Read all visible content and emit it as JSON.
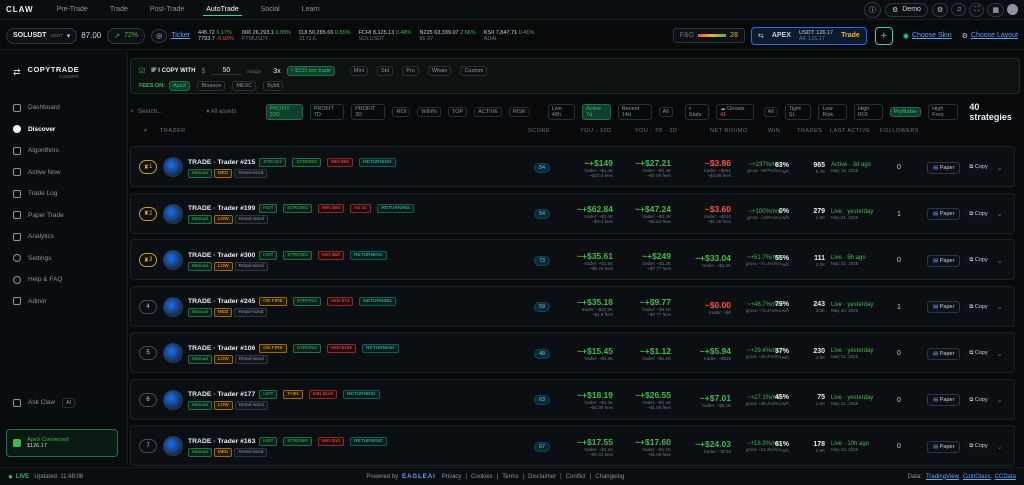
{
  "header": {
    "logo": "CLAW",
    "nav": [
      "Pre-Trade",
      "Trade",
      "Post-Trade",
      "AutoTrade",
      "Social",
      "Learn"
    ],
    "demo": "Demo"
  },
  "ticker": {
    "symbol": "SOLUSDT",
    "tag": "USDT",
    "price": "87.00",
    "change": "72%",
    "ticker_label": "Ticker",
    "quotes": [
      {
        "a": "445.72",
        "b": "0.17%",
        "c": "7793.7",
        "d": "-0.03%"
      },
      {
        "a": "000",
        "b": "26,293.1",
        "c": "0.09%",
        "d": "FTMUSDT"
      },
      {
        "a": "DJI",
        "b": "50,285.66",
        "c": "0.55%",
        "d": "2173.6"
      },
      {
        "a": "FCHI",
        "b": "8,125.13",
        "c": "0.48%",
        "d": "SOLUSDT"
      },
      {
        "a": "N225",
        "b": "63,339.07",
        "c": "2.66%",
        "d": "86.97"
      },
      {
        "a": "KSII",
        "b": "7,847.71",
        "c": "0.41%",
        "d": "ADAI"
      }
    ],
    "fng_label": "F&G",
    "fng_val": "28",
    "apex": "APEX",
    "apex_usdt": "USDT: 126.17",
    "apex_all": "All: 126.17",
    "trade_btn": "Trade",
    "skin": "Choose Skin",
    "layout": "Choose Layout"
  },
  "sidebar": {
    "title": "COPYTRADE",
    "subtitle": "COCKPIT",
    "items": [
      "Dashboard",
      "Discover",
      "Algorithms",
      "Active Now",
      "Trade Log",
      "Paper Trade",
      "Analytics",
      "Settings",
      "Help & FAQ",
      "Admin"
    ],
    "ask": "Ask Claw",
    "ai": "AI",
    "conn": "ApeX Connected",
    "bal": "$126.17"
  },
  "filters": {
    "label": "IF I COPY WITH",
    "amount": "50",
    "margin": "margin",
    "lev": "3x",
    "per": "≈ $150 per trade",
    "risks": [
      "Mini",
      "Std",
      "Pro",
      "Whale",
      "Custom"
    ],
    "fees_label": "FEES ON:",
    "fees": [
      "ApeX",
      "Binance",
      "MEXC",
      "Bybit"
    ]
  },
  "toolbar": {
    "search": "Search...",
    "assets": "All assets",
    "tabs": [
      "PROFIT 30D",
      "PROFIT 7D",
      "PROFIT 3D",
      "ROI",
      "WIN%",
      "TOP",
      "ACTIVE",
      "RISK"
    ],
    "time": [
      "Live 48h",
      "Active 7d",
      "Recent 14d",
      "All"
    ],
    "state": "State",
    "ghosts": "Ghosts",
    "ghost_n": "41",
    "filters2": [
      "All",
      "Tight SL",
      "Low Risk",
      "High ROI",
      "Profitable",
      "High Freq"
    ],
    "count": "40 strategies"
  },
  "columns": [
    "#",
    "TRADER",
    "SCORE",
    "YOU · 30D",
    "YOU · 7D · 3D",
    "NET ROI/MO",
    "WIN",
    "TRADES",
    "LAST ACTIVE",
    "FOLLOWERS"
  ],
  "rows": [
    {
      "rank": "1",
      "name": "TRADE · Trader #215",
      "tags": [
        "STEADY",
        "STRONG",
        "MIN $50",
        "RETURNING"
      ],
      "risk": "MED",
      "score": "54",
      "p30": "~+$149",
      "p30s": "trader: ~$1.4K",
      "p30f": "~$30.6 fees",
      "p7": "~+$27.21",
      "p7s": "trader: ~$1.4K",
      "p7f": "~$7.00 fees",
      "p3": "~$3.86",
      "p3s": "trader: ~$421",
      "p3f": "~$3.86 fees",
      "roi": "~+237%/mo",
      "roi2": "gross ~287%/mo",
      "win": "63%",
      "wins": "w/h",
      "tr": "965",
      "trs": "6.7K",
      "last": "Active · 3d ago",
      "lastd": "May 18, 2025",
      "fol": "0"
    },
    {
      "rank": "2",
      "name": "TRADE · Trader #199",
      "tags": [
        "HOT",
        "STRONG",
        "MIN $50",
        "No SL",
        "RETURNING"
      ],
      "risk": "LOW",
      "score": "54",
      "p30": "~+$62.84",
      "p30s": "trader: ~$2.4K",
      "p30f": "~$3.4 fees",
      "p7": "~+$47.24",
      "p7s": "trader: ~$2.4K",
      "p7f": "~$2.64 fees",
      "p3": "~$3.60",
      "p3s": "trader: ~$140",
      "p3f": "~$1.26 fees",
      "roi": "~+100%/mo",
      "roi2": "gross ~120%/mo",
      "win": "0%",
      "wins": "w/h",
      "tr": "279",
      "trs": "1.6K",
      "last": "Live · yesterday",
      "lastd": "May 21, 2025",
      "fol": "1"
    },
    {
      "rank": "3",
      "name": "TRADE · Trader #300",
      "tags": [
        "HOT",
        "STRONG",
        "MIN $50",
        "RETURNING"
      ],
      "risk": "LOW",
      "score": "73",
      "p30": "~+$35.61",
      "p30s": "trader: ~$1.5K",
      "p30f": "~$6.76 fees",
      "p7": "~+$249",
      "p7s": "trader: ~$2.3K",
      "p7f": "~$7.77 fees",
      "p3": "~+$33.04",
      "p3s": "trader: ~$2.3K",
      "p3f": "",
      "roi": "~+51.7%/mo",
      "roi2": "gross ~71.4%/mo",
      "win": "55%",
      "wins": "w/h",
      "tr": "111",
      "trs": "2.2K",
      "last": "Live · 5h ago",
      "lastd": "May 22, 2025",
      "fol": "0"
    },
    {
      "rank": "4",
      "name": "TRADE · Trader #245",
      "tags": [
        "ON FIRE",
        "STRONG",
        "MIN $74",
        "RETURNING"
      ],
      "risk": "MED",
      "score": "59",
      "p30": "~+$35.18",
      "p30s": "trader: ~$22.9K",
      "p30f": "~$1.8 fees",
      "p7": "~+$9.77",
      "p7s": "trader: ~$8.1K",
      "p7f": "~$7.77 fees",
      "p3": "~$0.00",
      "p3s": "trader: ~$0",
      "p3f": "",
      "roi": "~+46.7%/mo",
      "roi2": "gross ~76.4%/mo",
      "win": "79%",
      "wins": "w/h",
      "tr": "243",
      "trs": "3.6K",
      "last": "Live · yesterday",
      "lastd": "May 20, 2025",
      "fol": "1"
    },
    {
      "rank": "5",
      "name": "TRADE · Trader #106",
      "tags": [
        "ON FIRE",
        "STRONG",
        "MIN $169",
        "RETURNING"
      ],
      "risk": "LOW",
      "score": "48",
      "p30": "~+$15.45",
      "p30s": "trader: ~$1.9K",
      "p30f": "",
      "p7": "~+$1.12",
      "p7s": "trader: ~$1.1K",
      "p7f": "",
      "p3": "~+$5.94",
      "p3s": "trader: ~$519",
      "p3f": "",
      "roi": "~+29.4%/mo",
      "roi2": "gross ~40.4%/mo",
      "win": "37%",
      "wins": "w/h",
      "tr": "230",
      "trs": "4.5K",
      "last": "Live · yesterday",
      "lastd": "May 21, 2025",
      "fol": "0"
    },
    {
      "rank": "6",
      "name": "TRADE · Trader #177",
      "tags": [
        "HOT",
        "THIN",
        "MIN $118",
        "RETURNING"
      ],
      "risk": "LOW",
      "score": "63",
      "p30": "~+$18.19",
      "p30s": "trader: ~$1.3K",
      "p30f": "~$4.35 fees",
      "p7": "~+$26.55",
      "p7s": "trader: ~$1.1K",
      "p7f": "~$1.05 fees",
      "p3": "~+$7.01",
      "p3s": "trader: ~$6.1K",
      "p3f": "",
      "roi": "~+27.1%/mo",
      "roi2": "gross ~36.4%/mo",
      "win": "45%",
      "wins": "w/h",
      "tr": "75",
      "trs": "1.6K",
      "last": "Live · yesterday",
      "lastd": "May 21, 2025",
      "fol": "0"
    },
    {
      "rank": "7",
      "name": "TRADE · Trader #163",
      "tags": [
        "HOT",
        "STRONG",
        "MIN $10",
        "RETURNING"
      ],
      "risk": "MED",
      "score": "67",
      "p30": "~+$17.55",
      "p30s": "trader: ~$2.1K",
      "p30f": "~$0.42 fees",
      "p7": "~+$17.60",
      "p7s": "trader: ~$1.1K",
      "p7f": "~$1.06 fees",
      "p3": "~+$24.03",
      "p3s": "trader: ~$716",
      "p3f": "",
      "roi": "~+18.3%/mo",
      "roi2": "gross ~21.3%/mo",
      "win": "61%",
      "wins": "w/h",
      "tr": "178",
      "trs": "2.8K",
      "last": "Live · 10h ago",
      "lastd": "May 22, 2025",
      "fol": "0"
    }
  ],
  "row_labels": {
    "manual": "Manual",
    "retail": "Retail-sized",
    "paper": "Paper",
    "copy": "Copy"
  },
  "footer": {
    "live": "LIVE",
    "updated": "Updated: 11:48:08",
    "powered": "Powered by",
    "brand": "EAGLEAI",
    "links": [
      "Privacy",
      "Cookies",
      "Terms",
      "Disclaimer",
      "Conflict",
      "Changelog"
    ],
    "data": "Data:",
    "sources": [
      "TradingView",
      "CoinGlass",
      "CCData"
    ]
  }
}
